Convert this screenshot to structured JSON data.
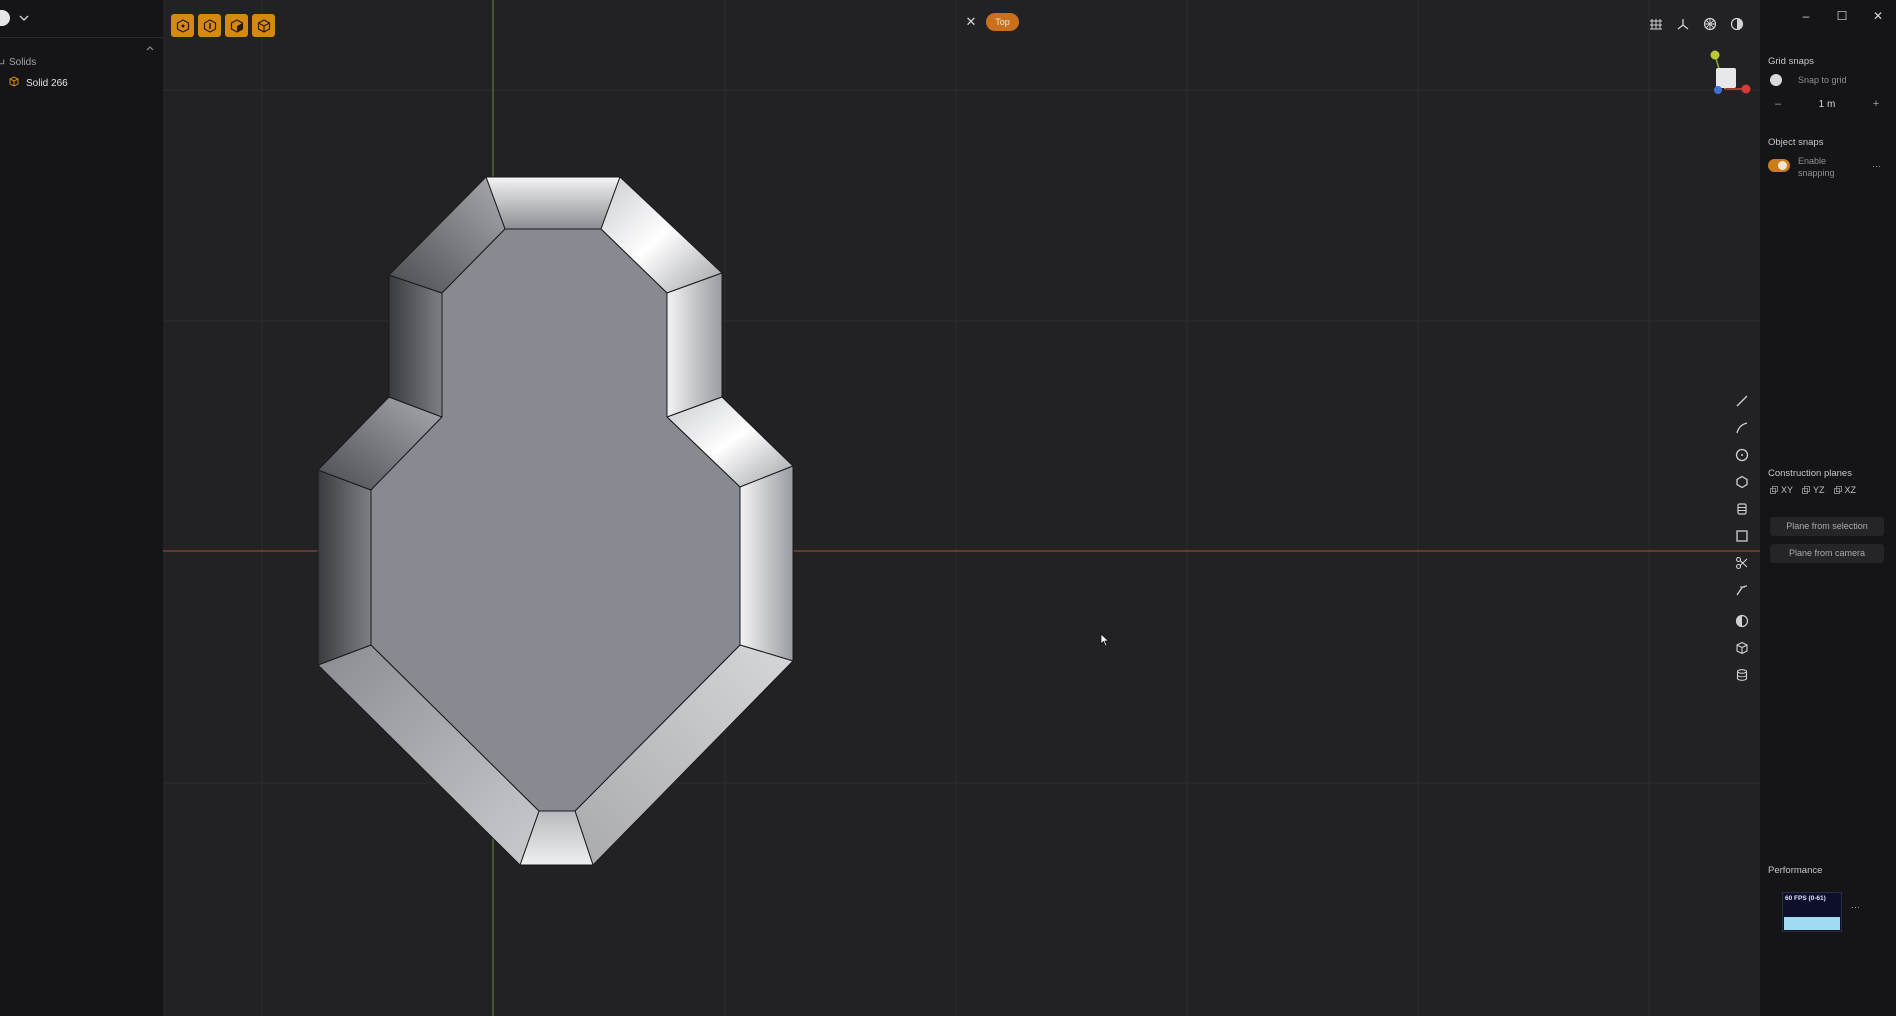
{
  "outliner": {
    "section_label": "Solids",
    "items": [
      {
        "label": "Solid 266",
        "icon": "solid-cube-icon"
      }
    ]
  },
  "viewport": {
    "view_name": "Top",
    "close_symbol": "✕",
    "selection_modes": [
      "vertex-mode-icon",
      "edge-mode-icon",
      "face-mode-icon",
      "solid-mode-icon"
    ],
    "view_toggles": [
      "grid-toggle-icon",
      "axes-toggle-icon",
      "snap-target-icon",
      "render-mode-icon"
    ],
    "tools": [
      "line-tool-icon",
      "curve-tool-icon",
      "circle-tool-icon",
      "polygon-tool-icon",
      "stack-tool-icon",
      "rectangle-tool-icon",
      "cut-tool-icon",
      "fillet-tool-icon",
      "boolean-tool-icon",
      "box-tool-icon",
      "cylinder-tool-icon"
    ],
    "axis_colors": {
      "x": "#b34a3c",
      "y": "#6f8a3c"
    },
    "accent": "#d48a12"
  },
  "right_panel": {
    "window_controls": {
      "minimize": "–",
      "maximize": "☐",
      "close": "✕"
    },
    "grid_snaps": {
      "title": "Grid snaps",
      "snap_to_grid_label": "Snap to grid",
      "minus": "–",
      "plus": "+",
      "value": "1 m"
    },
    "object_snaps": {
      "title": "Object snaps",
      "enable_label_line1": "Enable",
      "enable_label_line2": "snapping",
      "more": "···"
    },
    "construction_planes": {
      "title": "Construction planes",
      "planes": [
        "XY",
        "YZ",
        "XZ"
      ],
      "plane_from_selection": "Plane from selection",
      "plane_from_camera": "Plane from camera"
    },
    "performance": {
      "title": "Performance",
      "fps_label": "60 FPS (0-61)",
      "more": "···"
    }
  }
}
